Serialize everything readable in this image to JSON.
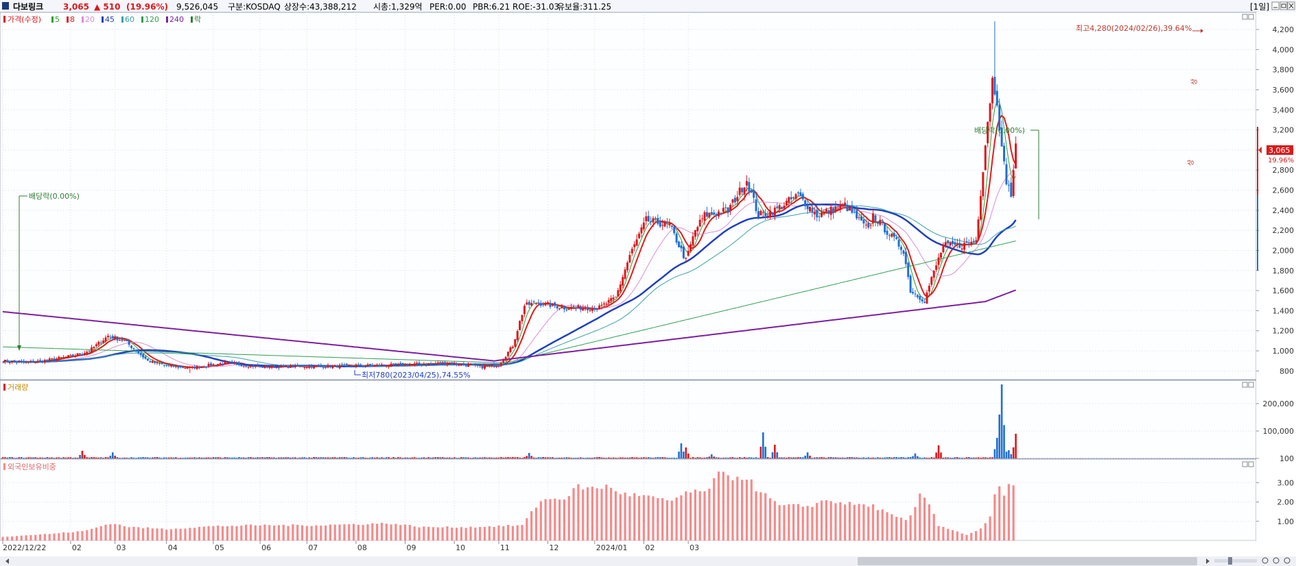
{
  "header": {
    "stock_name": "다보링크",
    "price": "3,065",
    "change": "▲ 510",
    "change_pct": "(19.96%)",
    "volume": "9,526,045",
    "market": "구분:KOSDAQ",
    "listed": "상장수:43,388,212",
    "mcap": "시총:1,329억",
    "per": "PER:0.00",
    "pbr": "PBR:6.21",
    "roe": "ROE:-31.03",
    "float": "유보율:311.25",
    "period_button": "[1일]"
  },
  "legend": {
    "price_label": "가격(수정)",
    "items": [
      {
        "label": "5",
        "color": "#2ca02c"
      },
      {
        "label": "8",
        "color": "#e31a1c"
      },
      {
        "label": "20",
        "color": "#d58fd8"
      },
      {
        "label": "45",
        "color": "#1f3fbf"
      },
      {
        "label": "60",
        "color": "#3aa0a8"
      },
      {
        "label": "120",
        "color": "#2e9e4e"
      },
      {
        "label": "240",
        "color": "#7b1fa2"
      },
      {
        "label": "락",
        "color": "#2e7d32"
      }
    ]
  },
  "volume_panel": {
    "title": "거래량"
  },
  "foreign_panel": {
    "title": "외국인보유비중"
  },
  "annotations": {
    "max": "최고4,280(2024/02/26),39.64%",
    "min": "최저780(2023/04/25),74.55%",
    "div1": "배당락(0.00%)",
    "div2": "배당락(0.00%)",
    "up1": "상",
    "up2": "상"
  },
  "current_tag": {
    "price": "3,065",
    "pct": "19.96%"
  },
  "x_labels": [
    "2022/12/22",
    "02",
    "03",
    "04",
    "05",
    "06",
    "07",
    "08",
    "09",
    "10",
    "11",
    "12",
    "2024/01",
    "02",
    "03"
  ],
  "colors": {
    "up": "#e0161b",
    "down": "#1f6fd1",
    "bg": "#fdfeff",
    "grid": "#d6dbe6",
    "axis": "#8a8f99",
    "foreign": "#f58a8a"
  },
  "chart_data": [
    {
      "type": "candlestick",
      "title": "가격(수정)",
      "yticks": [
        800,
        1000,
        1200,
        1400,
        1600,
        1800,
        2000,
        2200,
        2400,
        2600,
        2800,
        3000,
        3200,
        3400,
        3600,
        3800,
        4000,
        4200
      ],
      "ylim": [
        650,
        4450
      ],
      "last_close": 3065,
      "high": {
        "value": 4280,
        "date": "2024/02/26"
      },
      "low": {
        "value": 780,
        "date": "2023/04/25"
      },
      "close_anchors": [
        [
          0,
          900
        ],
        [
          10,
          880
        ],
        [
          20,
          910
        ],
        [
          30,
          950
        ],
        [
          37,
          1000
        ],
        [
          45,
          1150
        ],
        [
          52,
          1100
        ],
        [
          62,
          900
        ],
        [
          70,
          850
        ],
        [
          80,
          830
        ],
        [
          95,
          880
        ],
        [
          110,
          840
        ],
        [
          130,
          845
        ],
        [
          150,
          850
        ],
        [
          170,
          860
        ],
        [
          190,
          880
        ],
        [
          205,
          840
        ],
        [
          212,
          860
        ],
        [
          218,
          1050
        ],
        [
          223,
          1450
        ],
        [
          228,
          1480
        ],
        [
          240,
          1430
        ],
        [
          255,
          1430
        ],
        [
          262,
          1530
        ],
        [
          268,
          1950
        ],
        [
          275,
          2300
        ],
        [
          285,
          2250
        ],
        [
          292,
          1900
        ],
        [
          296,
          2200
        ],
        [
          300,
          2350
        ],
        [
          310,
          2400
        ],
        [
          318,
          2700
        ],
        [
          323,
          2350
        ],
        [
          330,
          2400
        ],
        [
          340,
          2550
        ],
        [
          348,
          2350
        ],
        [
          360,
          2450
        ],
        [
          370,
          2200
        ],
        [
          372,
          2350
        ],
        [
          385,
          2000
        ],
        [
          388,
          1600
        ],
        [
          394,
          1500
        ],
        [
          396,
          1650
        ],
        [
          402,
          2050
        ],
        [
          410,
          2050
        ],
        [
          416,
          2100
        ],
        [
          421,
          3300
        ],
        [
          423,
          3700
        ],
        [
          425,
          3500
        ],
        [
          427,
          3000
        ],
        [
          429,
          2700
        ],
        [
          431,
          2550
        ],
        [
          433,
          3065
        ]
      ],
      "series": [
        {
          "name": "5",
          "color": "#2ca02c"
        },
        {
          "name": "8",
          "color": "#e31a1c"
        },
        {
          "name": "20",
          "color": "#d58fd8"
        },
        {
          "name": "45",
          "color": "#1f3fbf"
        },
        {
          "name": "60",
          "color": "#3aa0a8"
        },
        {
          "name": "120",
          "color": "#2e9e4e"
        },
        {
          "name": "240",
          "color": "#7b1fa2"
        }
      ]
    },
    {
      "type": "bar",
      "title": "거래량",
      "yticks": [
        100,
        100000,
        200000
      ],
      "ytick_labels": [
        "100",
        "100,000",
        "200,000"
      ],
      "ylim": [
        0,
        250000
      ],
      "spikes": [
        [
          34,
          28000
        ],
        [
          47,
          22000
        ],
        [
          180,
          4000
        ],
        [
          225,
          20000
        ],
        [
          240,
          3000
        ],
        [
          290,
          55000
        ],
        [
          292,
          40000
        ],
        [
          303,
          15000
        ],
        [
          325,
          95000
        ],
        [
          330,
          50000
        ],
        [
          344,
          22000
        ],
        [
          390,
          18000
        ],
        [
          400,
          48000
        ],
        [
          425,
          75000
        ],
        [
          426,
          160000
        ],
        [
          427,
          270000
        ],
        [
          428,
          55000
        ],
        [
          430,
          30000
        ],
        [
          432,
          35000
        ],
        [
          433,
          90000
        ]
      ]
    },
    {
      "type": "bar",
      "title": "외국인보유비중",
      "yticks": [
        1.0,
        2.0,
        3.0
      ],
      "ytick_labels": [
        "1.00",
        "2.00",
        "3.00"
      ],
      "ylim": [
        0,
        3.9
      ],
      "anchors": [
        [
          0,
          0.2
        ],
        [
          20,
          0.35
        ],
        [
          35,
          0.5
        ],
        [
          46,
          0.9
        ],
        [
          55,
          0.7
        ],
        [
          70,
          0.6
        ],
        [
          90,
          0.75
        ],
        [
          110,
          0.8
        ],
        [
          135,
          0.8
        ],
        [
          165,
          0.9
        ],
        [
          180,
          0.7
        ],
        [
          200,
          0.7
        ],
        [
          222,
          0.8
        ],
        [
          230,
          2.1
        ],
        [
          240,
          2.2
        ],
        [
          246,
          2.8
        ],
        [
          250,
          2.7
        ],
        [
          258,
          2.8
        ],
        [
          266,
          2.4
        ],
        [
          275,
          2.3
        ],
        [
          285,
          2.0
        ],
        [
          292,
          2.5
        ],
        [
          300,
          2.5
        ],
        [
          306,
          3.4
        ],
        [
          312,
          3.3
        ],
        [
          318,
          3.3
        ],
        [
          322,
          2.7
        ],
        [
          332,
          1.8
        ],
        [
          345,
          1.8
        ],
        [
          352,
          2.1
        ],
        [
          362,
          1.9
        ],
        [
          372,
          1.8
        ],
        [
          380,
          1.3
        ],
        [
          387,
          1.0
        ],
        [
          392,
          2.3
        ],
        [
          395,
          2.2
        ],
        [
          400,
          0.8
        ],
        [
          412,
          0.3
        ],
        [
          418,
          0.6
        ],
        [
          422,
          1.2
        ],
        [
          425,
          2.9
        ],
        [
          428,
          2.3
        ],
        [
          431,
          3.0
        ],
        [
          433,
          3.0
        ]
      ]
    }
  ]
}
